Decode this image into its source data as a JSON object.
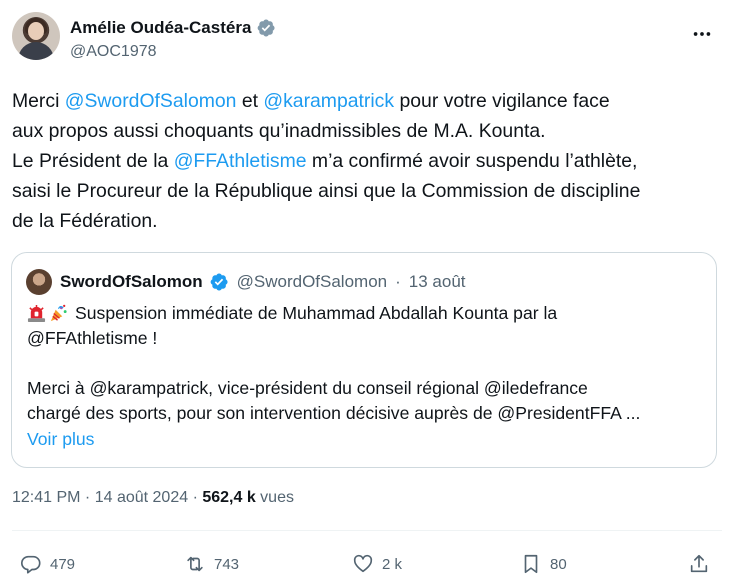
{
  "author": {
    "name": "Amélie Oudéa-Castéra",
    "handle": "@AOC1978"
  },
  "tweet": {
    "segments": [
      {
        "t": "Merci ",
        "m": false
      },
      {
        "t": "@SwordOfSalomon",
        "m": true
      },
      {
        "t": " et ",
        "m": false
      },
      {
        "t": "@karampatrick",
        "m": true
      },
      {
        "t": " pour votre vigilance face\naux propos aussi choquants qu’inadmissibles de M.A. Kounta.\nLe Président de la ",
        "m": false
      },
      {
        "t": "@FFAthletisme",
        "m": true
      },
      {
        "t": " m’a confirmé avoir suspendu l’athlète,\nsaisi le Procureur de la République ainsi que la Commission de discipline\nde la Fédération.",
        "m": false
      }
    ]
  },
  "quote": {
    "name": "SwordOfSalomon",
    "handle": "@SwordOfSalomon",
    "separator": "·",
    "date": "13 août",
    "emojis": [
      "rotating-light-emoji",
      "party-popper-emoji"
    ],
    "lines": [
      "Suspension immédiate de Muhammad Abdallah Kounta par la",
      "@FFAthletisme !",
      "",
      "Merci à @karampatrick, vice-président du conseil régional @iledefrance",
      "chargé des sports, pour son intervention décisive auprès de @PresidentFFA ..."
    ],
    "show_more": "Voir plus"
  },
  "meta": {
    "time": "12:41 PM",
    "separator": " · ",
    "date": "14 août 2024",
    "separator2": " · ",
    "views_count": "562,4 k",
    "views_label": " vues"
  },
  "actions": {
    "replies": "479",
    "reposts": "743",
    "likes": "2 k",
    "bookmarks": "80"
  },
  "colors": {
    "accent": "#1d9bf0",
    "text": "#0f1419",
    "secondary": "#536471",
    "border": "#cfd9de"
  }
}
